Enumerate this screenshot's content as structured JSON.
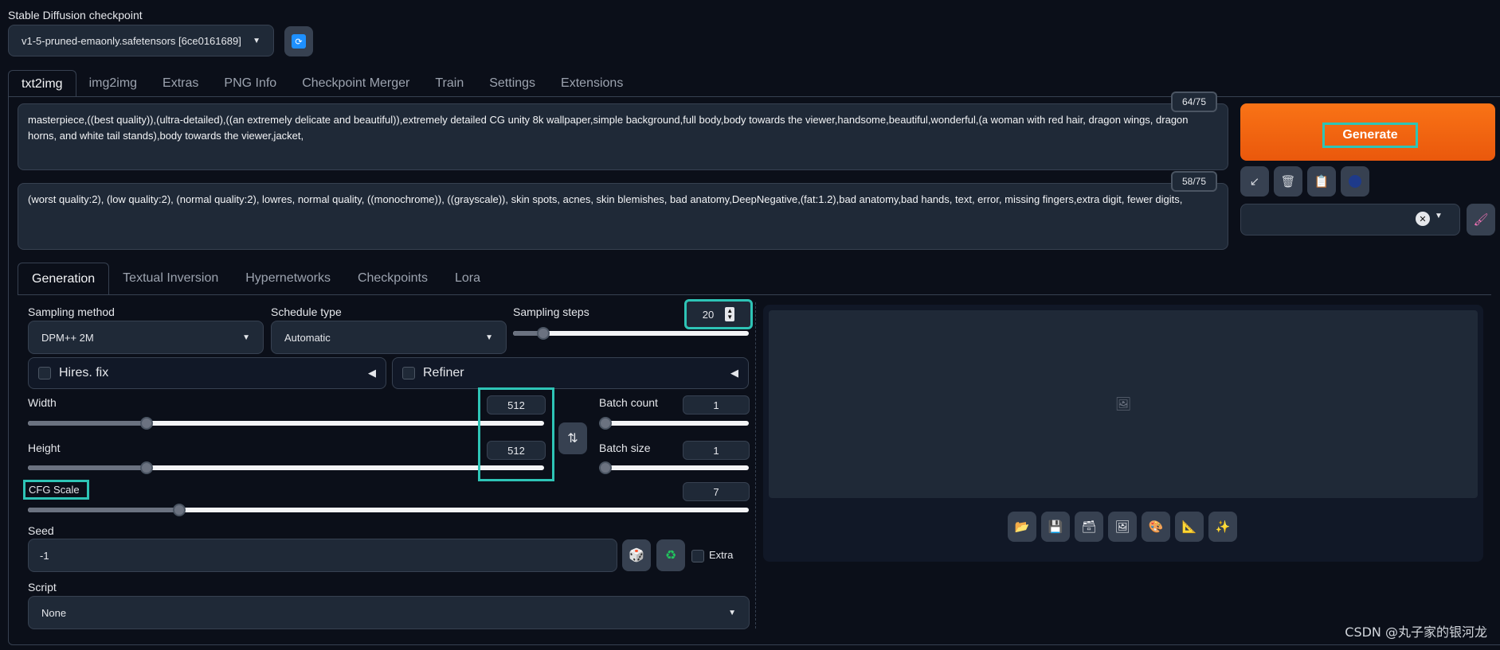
{
  "checkpoint": {
    "label": "Stable Diffusion checkpoint",
    "value": "v1-5-pruned-emaonly.safetensors [6ce0161689]",
    "refresh_icon": "refresh-icon"
  },
  "top_tabs": [
    "txt2img",
    "img2img",
    "Extras",
    "PNG Info",
    "Checkpoint Merger",
    "Train",
    "Settings",
    "Extensions"
  ],
  "prompt": {
    "positive": "masterpiece,((best quality)),(ultra-detailed),((an extremely delicate and beautiful)),extremely detailed CG unity 8k wallpaper,simple background,full body,body towards the viewer,handsome,beautiful,wonderful,(a woman with red hair, dragon wings, dragon horns, and white tail stands),body towards the viewer,jacket,",
    "positive_tokens": "64/75",
    "negative": "(worst quality:2), (low quality:2), (normal quality:2), lowres, normal quality, ((monochrome)), ((grayscale)), skin spots, acnes, skin blemishes, bad anatomy,DeepNegative,(fat:1.2),bad anatomy,bad hands, text, error, missing fingers,extra digit, fewer digits,",
    "negative_tokens": "58/75"
  },
  "generate_label": "Generate",
  "sub_tabs": [
    "Generation",
    "Textual Inversion",
    "Hypernetworks",
    "Checkpoints",
    "Lora"
  ],
  "generation": {
    "sampling_method_label": "Sampling method",
    "sampling_method_value": "DPM++ 2M",
    "schedule_type_label": "Schedule type",
    "schedule_type_value": "Automatic",
    "sampling_steps_label": "Sampling steps",
    "sampling_steps_value": "20",
    "sampling_steps_fraction": 0.13,
    "hires_label": "Hires. fix",
    "refiner_label": "Refiner",
    "width_label": "Width",
    "width_value": "512",
    "width_fraction": 0.23,
    "height_label": "Height",
    "height_value": "512",
    "height_fraction": 0.23,
    "batch_count_label": "Batch count",
    "batch_count_value": "1",
    "batch_size_label": "Batch size",
    "batch_size_value": "1",
    "cfg_label": "CFG Scale",
    "cfg_value": "7",
    "cfg_fraction": 0.21,
    "seed_label": "Seed",
    "seed_value": "-1",
    "extra_label": "Extra",
    "script_label": "Script",
    "script_value": "None"
  },
  "watermark": "CSDN @丸子家的银河龙",
  "colors": {
    "accent": "#ea580c",
    "highlight": "#2ec4b6",
    "bg": "#0b0f19",
    "panel": "#1f2937"
  }
}
